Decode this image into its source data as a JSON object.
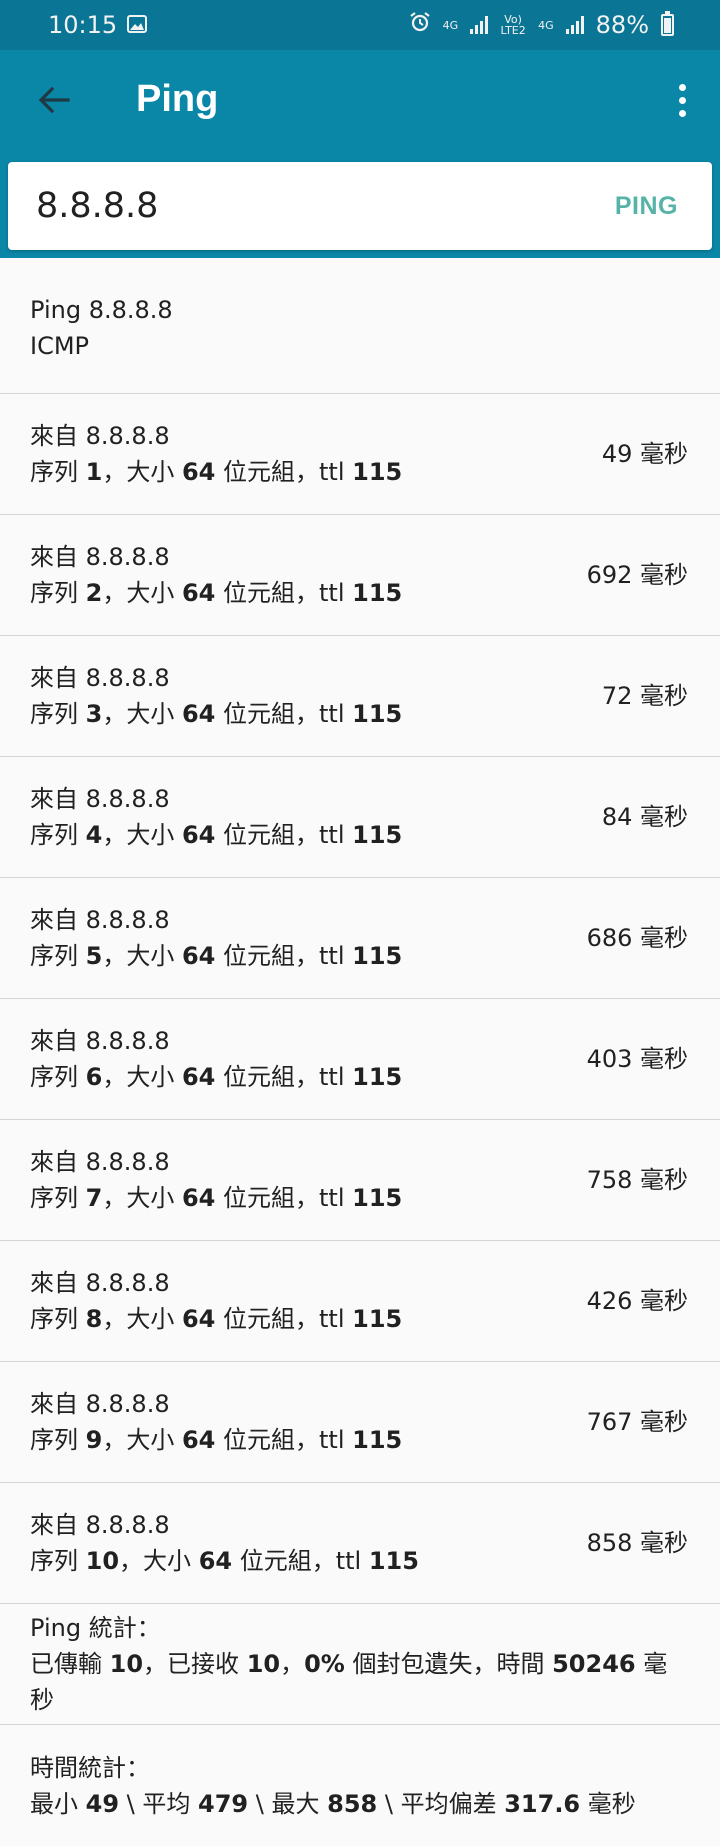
{
  "status_bar": {
    "time": "10:15",
    "net_label_1": "4G",
    "volte_label": "Vo) LTE2",
    "net_label_2": "4G",
    "battery": "88%"
  },
  "toolbar": {
    "title": "Ping"
  },
  "search": {
    "host_value": "8.8.8.8",
    "button_label": "PING"
  },
  "ping_header": {
    "line1": "Ping 8.8.8.8",
    "line2": "ICMP"
  },
  "reply_text": {
    "from": "來自 8.8.8.8",
    "seq_prefix": "序列 ",
    "size_prefix": "，大小 ",
    "size_value": "64",
    "size_suffix": " 位元組，ttl ",
    "ttl_value": "115"
  },
  "replies": [
    {
      "seq": "1",
      "time": "49 毫秒"
    },
    {
      "seq": "2",
      "time": "692 毫秒"
    },
    {
      "seq": "3",
      "time": "72 毫秒"
    },
    {
      "seq": "4",
      "time": "84 毫秒"
    },
    {
      "seq": "5",
      "time": "686 毫秒"
    },
    {
      "seq": "6",
      "time": "403 毫秒"
    },
    {
      "seq": "7",
      "time": "758 毫秒"
    },
    {
      "seq": "8",
      "time": "426 毫秒"
    },
    {
      "seq": "9",
      "time": "767 毫秒"
    },
    {
      "seq": "10",
      "time": "858 毫秒"
    }
  ],
  "ping_stats": {
    "title_bold": "Ping",
    "title_rest": " 統計：",
    "sent_label": "已傳輸 ",
    "sent": "10",
    "recv_label": "，已接收 ",
    "recv": "10",
    "loss_sep": "，",
    "loss": "0%",
    "loss_label": " 個封包遺失，時間 ",
    "total_time": "50246",
    "unit": " 毫秒"
  },
  "time_stats": {
    "title": "時間統計：",
    "min_label": "最小 ",
    "min": "49",
    "avg_label": " \\ 平均 ",
    "avg": "479",
    "max_label": " \\ 最大 ",
    "max": "858",
    "dev_label": " \\ 平均偏差 ",
    "dev": "317.6",
    "unit": " 毫秒"
  }
}
